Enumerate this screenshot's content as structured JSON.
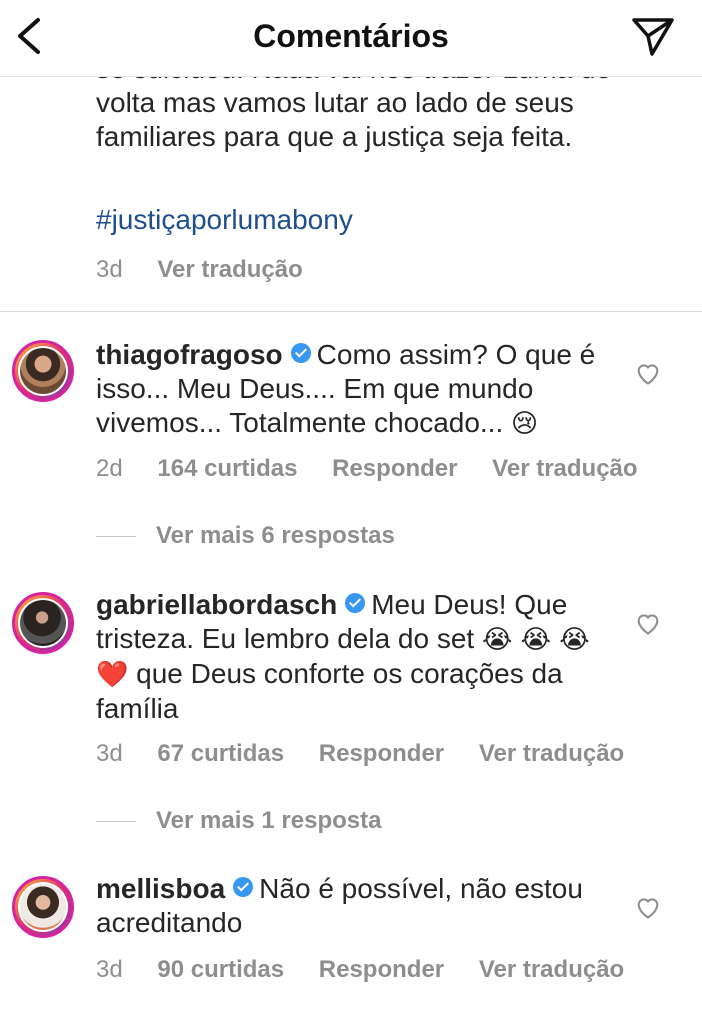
{
  "header": {
    "title": "Comentários"
  },
  "caption": {
    "lines": [
      "se suicidou. Nada vai nos trazer Luma de",
      "volta mas vamos lutar ao lado de seus",
      "familiares para que a justiça seja feita."
    ],
    "hashtag": "#justiçaporlumabony",
    "time": "3d",
    "translate": "Ver tradução"
  },
  "comments": [
    {
      "username": "thiagofragoso",
      "text": "Como assim? O que é isso... Meu Deus.... Em que mundo vivemos... Totalmente chocado...",
      "emoji": "😢",
      "time": "2d",
      "likes": "164 curtidas",
      "reply": "Responder",
      "translate": "Ver tradução",
      "more_replies": "Ver mais 6 respostas"
    },
    {
      "username": "gabriellabordasch",
      "text": "Meu Deus! Que tristeza. Eu lembro dela do set",
      "emoji": "😭 😭 😭 ❤️",
      "text2": "que Deus conforte os corações da família",
      "time": "3d",
      "likes": "67 curtidas",
      "reply": "Responder",
      "translate": "Ver tradução",
      "more_replies": "Ver mais 1 resposta"
    },
    {
      "username": "mellisboa",
      "text": "Não é possível, não estou acreditando",
      "time": "3d",
      "likes": "90 curtidas",
      "reply": "Responder",
      "translate": "Ver tradução"
    }
  ],
  "colors": {
    "hashtag": "#1f4e8c",
    "verified": "#3897f0",
    "muted": "#8e8e8e"
  },
  "icons": {
    "back": "chevron-left-icon",
    "send": "paper-plane-icon",
    "like": "heart-outline-icon",
    "verified": "verified-badge-icon"
  }
}
